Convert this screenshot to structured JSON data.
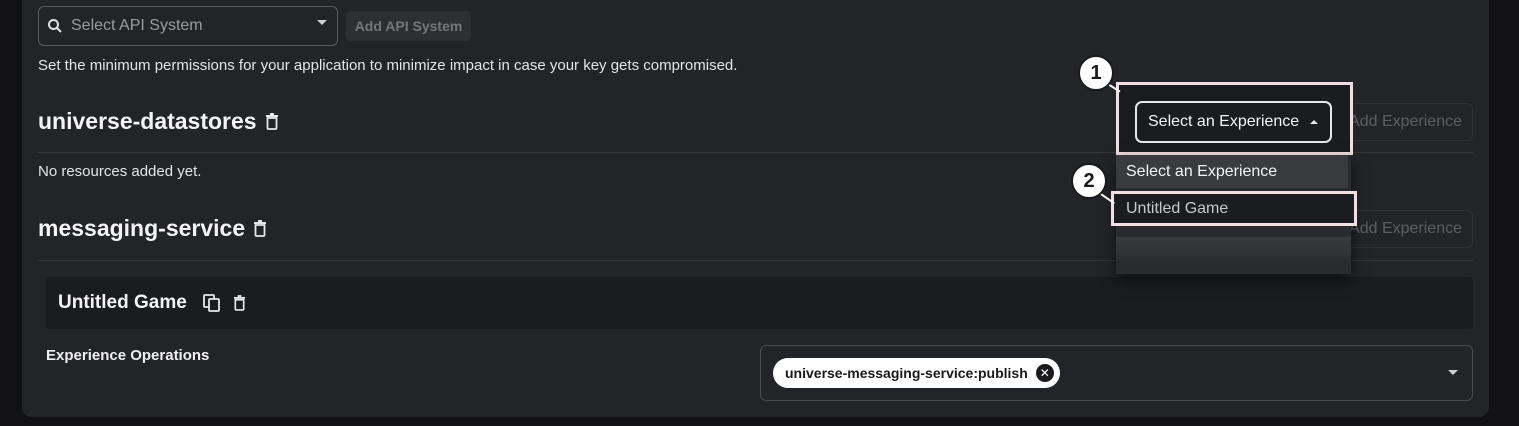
{
  "api_system": {
    "placeholder": "Select API System",
    "add_button": "Add API System"
  },
  "hint_text": "Set the minimum permissions for your application to minimize impact in case your key gets compromised.",
  "sections": [
    {
      "title": "universe-datastores",
      "empty_text": "No resources added yet.",
      "add_experience": "Add Experience"
    },
    {
      "title": "messaging-service",
      "add_experience": "Add Experience"
    }
  ],
  "experience_select": {
    "value": "Select an Experience",
    "options": [
      "Select an Experience",
      "Untitled Game"
    ]
  },
  "experience_card": {
    "title": "Untitled Game",
    "operations_label": "Experience Operations",
    "operations": [
      "universe-messaging-service:publish"
    ]
  },
  "annotations": [
    "1",
    "2"
  ],
  "icons": [
    "search-icon",
    "chevron-down-icon",
    "trash-icon",
    "copy-icon",
    "chevron-up-icon",
    "close-icon"
  ]
}
